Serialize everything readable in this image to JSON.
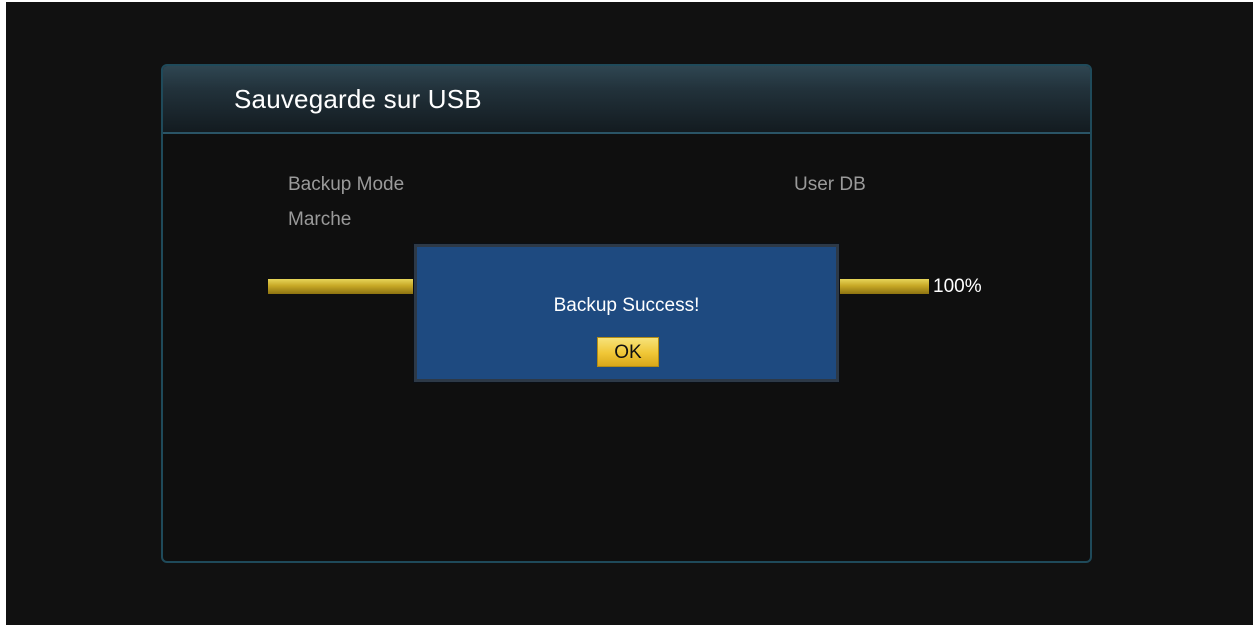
{
  "panel": {
    "title": "Sauvegarde sur USB"
  },
  "settings": {
    "backup_mode_label": "Backup Mode",
    "backup_mode_value": "User DB",
    "status_label": "Marche"
  },
  "progress": {
    "fraction": 1.0,
    "value_text": "100%"
  },
  "dialog": {
    "message": "Backup Success!",
    "ok_label": "OK"
  },
  "colors": {
    "dialog_background": "#1e4a80",
    "progress_fill": "#c7a826",
    "ok_button": "#f0c636"
  }
}
